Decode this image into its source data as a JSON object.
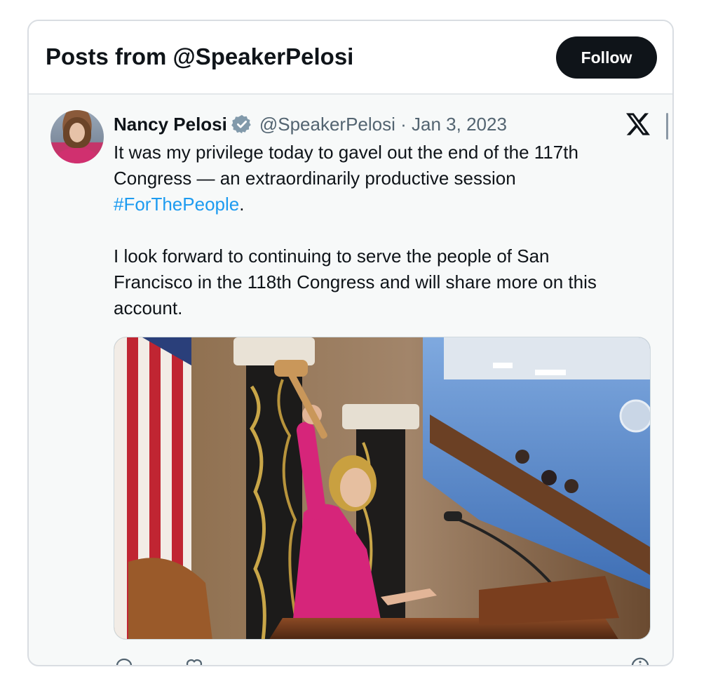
{
  "embed": {
    "header_title": "Posts from @SpeakerPelosi",
    "follow_label": "Follow"
  },
  "tweet": {
    "author_name": "Nancy Pelosi",
    "handle_date": "@SpeakerPelosi · Jan 3, 2023",
    "text_line1": "It was my privilege today to gavel out the end of the 117th",
    "text_line2": "Congress — an extraordinarily productive session",
    "hashtag": "#ForThePeople",
    "hashtag_suffix": ".",
    "text_para2_line1": "I look forward to continuing to serve the people of San",
    "text_para2_line2": "Francisco in the 118th Congress and will share more on this",
    "text_para2_line3": "account.",
    "image_description": "Photo of Nancy Pelosi in a pink suit raising a gavel at the House rostrum",
    "icons": {
      "verified": "verified-badge-icon",
      "platform": "x-logo-icon",
      "reply": "reply-icon",
      "like": "heart-icon",
      "info": "info-icon"
    }
  },
  "colors": {
    "accent_link": "#1d9bf0",
    "text_primary": "#0f1419",
    "text_secondary": "#536471",
    "follow_button_bg": "#0f1419"
  }
}
